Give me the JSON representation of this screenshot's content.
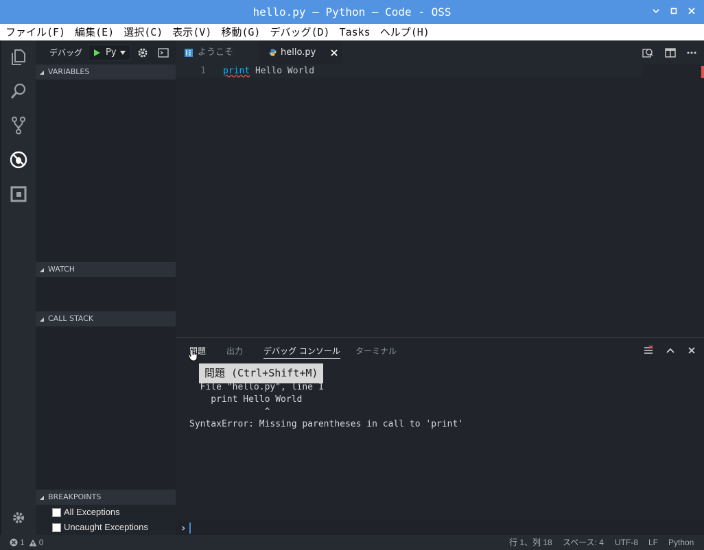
{
  "window": {
    "title": "hello.py — Python — Code - OSS",
    "min_label": "▾",
    "max_label": "▫",
    "close_label": "✕"
  },
  "menu": [
    "ファイル(F)",
    "編集(E)",
    "選択(C)",
    "表示(V)",
    "移動(G)",
    "デバッグ(D)",
    "Tasks",
    "ヘルプ(H)"
  ],
  "debug": {
    "label": "デバッグ",
    "config": "Py"
  },
  "sections": {
    "variables": "VARIABLES",
    "watch": "WATCH",
    "call_stack": "CALL STACK",
    "breakpoints": "BREAKPOINTS"
  },
  "breakpoints": [
    {
      "label": "All Exceptions",
      "checked": false
    },
    {
      "label": "Uncaught Exceptions",
      "checked": false
    }
  ],
  "tabs": [
    {
      "label": "ようこそ",
      "active": false
    },
    {
      "label": "hello.py",
      "active": true
    }
  ],
  "editor": {
    "line_number": "1",
    "keyword": "print",
    "rest": " Hello World"
  },
  "panel": {
    "tabs": [
      "問題",
      "出力",
      "デバッグ コンソール",
      "ターミナル"
    ],
    "active_tab": "デバッグ コンソール",
    "lines": [
      "  File \"hello.py\", line 1",
      "    print Hello World",
      "              ^",
      "SyntaxError: Missing parentheses in call to 'print'"
    ],
    "prompt": "›"
  },
  "tooltip": "問題 (Ctrl+Shift+M)",
  "status": {
    "errors": "1",
    "warnings": "0",
    "position": "行 1、列 18",
    "spaces": "スペース: 4",
    "encoding": "UTF-8",
    "eol": "LF",
    "language": "Python"
  },
  "colors": {
    "title_bar": "#5294e2",
    "keyword": "#00b7ff",
    "error_squiggle": "#e05252",
    "activity_active": "#ffffff",
    "play": "#5cdc5c",
    "python_icon": "#3b8fd9"
  },
  "icons": [
    "explorer-icon",
    "search-icon",
    "source-control-icon",
    "debug-icon",
    "extensions-icon",
    "settings-gear-icon",
    "play-icon",
    "gear-icon",
    "console-icon",
    "python-file-icon",
    "welcome-icon",
    "close-icon",
    "open-changes-icon",
    "split-editor-icon",
    "more-icon",
    "clear-console-icon",
    "chevron-up-icon",
    "error-icon",
    "warning-icon"
  ]
}
